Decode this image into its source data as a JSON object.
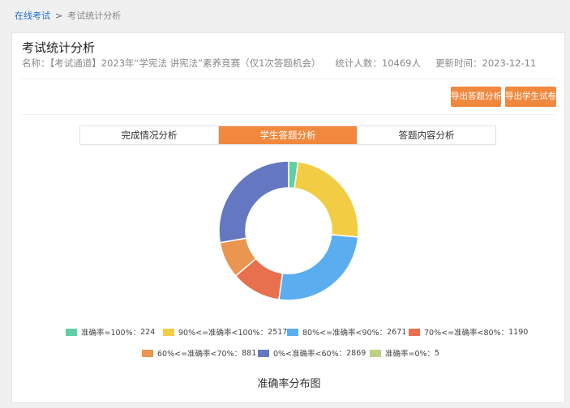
{
  "breadcrumb": {
    "home": "在线考试",
    "separator": ">",
    "current": "考试统计分析"
  },
  "page": {
    "title": "考试统计分析",
    "name_label": "名称：",
    "name_value": "【考试通道】2023年“学宪法 讲宪法”素养竞赛（仅1次答题机会）",
    "stat_label": "统计人数：",
    "stat_value": "10469人",
    "update_label": "更新时间：",
    "update_value": "2023-12-11"
  },
  "buttons": {
    "export_answer": "导出答题分析",
    "export_paper": "导出学生试卷"
  },
  "tabs": [
    {
      "label": "完成情况分析",
      "active": false
    },
    {
      "label": "学生答题分析",
      "active": true
    },
    {
      "label": "答题内容分析",
      "active": false
    }
  ],
  "accent_color": "#f0883e",
  "chart_data": {
    "type": "pie",
    "variant": "donut",
    "title": "准确率分布图",
    "legend_position": "bottom",
    "slices": [
      {
        "label": "准确率=100%",
        "value": 224,
        "color": "#5fcfa4"
      },
      {
        "label": "90%<=准确率<100%",
        "value": 2517,
        "color": "#f2cd44"
      },
      {
        "label": "80%<=准确率<90%",
        "value": 2671,
        "color": "#5aaef0"
      },
      {
        "label": "70%<=准确率<80%",
        "value": 1190,
        "color": "#e8704f"
      },
      {
        "label": "60%<=准确率<70%",
        "value": 881,
        "color": "#ea9550"
      },
      {
        "label": "0%<准确率<60%",
        "value": 2869,
        "color": "#6478c2"
      },
      {
        "label": "准确率=0%",
        "value": 5,
        "color": "#bcd184"
      }
    ]
  }
}
